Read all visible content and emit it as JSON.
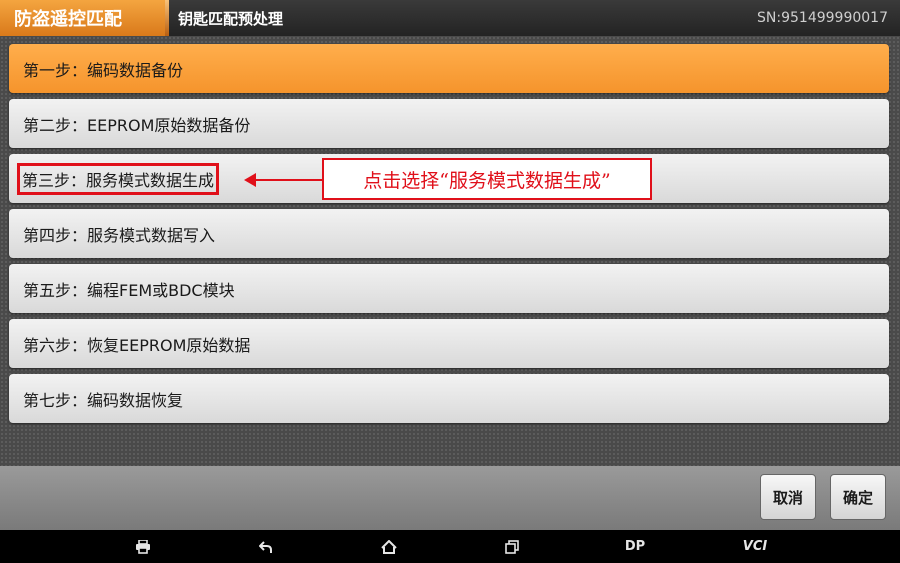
{
  "header": {
    "brand": "防盗遥控匹配",
    "subtitle": "钥匙匹配预处理",
    "serial": "SN:951499990017"
  },
  "steps": [
    {
      "label": "第一步：编码数据备份"
    },
    {
      "label": "第二步：EEPROM原始数据备份"
    },
    {
      "label": "第三步：服务模式数据生成"
    },
    {
      "label": "第四步：服务模式数据写入"
    },
    {
      "label": "第五步：编程FEM或BDC模块"
    },
    {
      "label": "第六步：恢复EEPROM原始数据"
    },
    {
      "label": "第七步：编码数据恢复"
    }
  ],
  "annotation": {
    "text": "点击选择“服务模式数据生成”",
    "color": "#e0101a"
  },
  "buttons": {
    "cancel": "取消",
    "confirm": "确定"
  },
  "navbar": {
    "items": [
      "print-icon",
      "back-icon",
      "home-icon",
      "recents-icon",
      "DP",
      "VCI"
    ],
    "dp": "DP",
    "vci": "VCI"
  },
  "colors": {
    "accent": "#f5942c",
    "highlight": "#e0101a"
  }
}
